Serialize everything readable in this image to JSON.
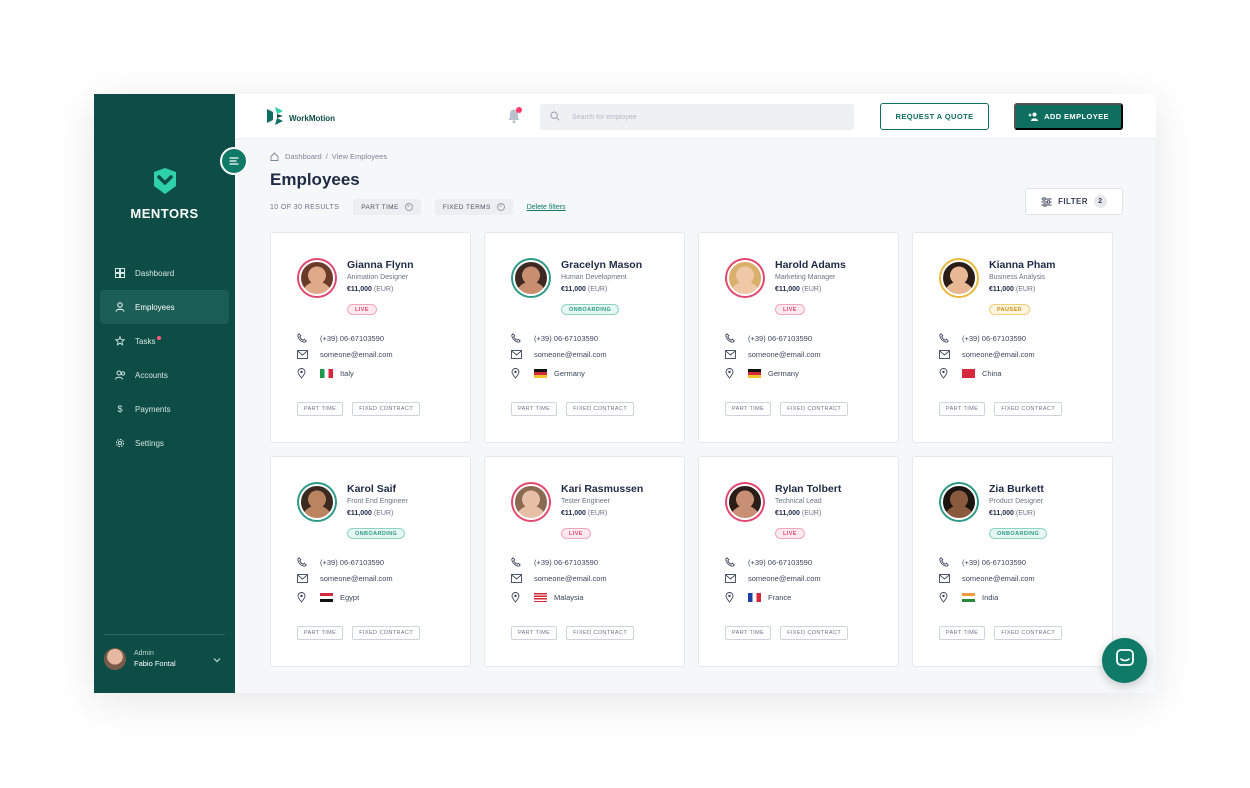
{
  "brand": {
    "name": "MENTORS"
  },
  "topbar": {
    "logo_text": "WorkMotion",
    "search_placeholder": "Search for employee",
    "request_quote": "REQUEST A QUOTE",
    "add_employee": "ADD EMPLOYEE"
  },
  "sidebar": {
    "items": [
      {
        "label": "Dashboard",
        "icon": "dashboard-icon"
      },
      {
        "label": "Employees",
        "icon": "user-icon",
        "active": true
      },
      {
        "label": "Tasks",
        "icon": "star-icon",
        "badge_dot": true
      },
      {
        "label": "Accounts",
        "icon": "users-icon"
      },
      {
        "label": "Payments",
        "icon": "dollar-icon"
      },
      {
        "label": "Settings",
        "icon": "gear-icon"
      }
    ],
    "user": {
      "role": "Admin",
      "name": "Fabio Fontal"
    }
  },
  "breadcrumb": {
    "home": "Dashboard",
    "separator": "/",
    "current": "View Employees"
  },
  "page": {
    "title": "Employees",
    "results": "10 OF 30 RESULTS",
    "filters": [
      "PART TIME",
      "FIXED TERMS"
    ],
    "delete_filters": "Delete filters",
    "filter_label": "FILTER",
    "filter_count": "2"
  },
  "employees": [
    {
      "name": "Gianna Flynn",
      "role": "Animation Designer",
      "salary": "€11,000",
      "currency": "(EUR)",
      "status": "LIVE",
      "phone": "(+39) 06-67103590",
      "email": "someone@email.com",
      "country": "Italy",
      "tags": [
        "PART TIME",
        "FIXED CONTRACT"
      ]
    },
    {
      "name": "Gracelyn Mason",
      "role": "Human Development",
      "salary": "€11,000",
      "currency": "(EUR)",
      "status": "ONBOARDING",
      "phone": "(+39) 06-67103590",
      "email": "someone@email.com",
      "country": "Germany",
      "tags": [
        "PART TIME",
        "FIXED CONTRACT"
      ]
    },
    {
      "name": "Harold Adams",
      "role": "Marketing Manager",
      "salary": "€11,000",
      "currency": "(EUR)",
      "status": "LIVE",
      "phone": "(+39) 06-67103590",
      "email": "someone@email.com",
      "country": "Germany",
      "tags": [
        "PART TIME",
        "FIXED CONTRACT"
      ]
    },
    {
      "name": "Kianna Pham",
      "role": "Business Analysis",
      "salary": "€11,000",
      "currency": "(EUR)",
      "status": "PAUSED",
      "phone": "(+39) 06-67103590",
      "email": "someone@email.com",
      "country": "China",
      "tags": [
        "PART TIME",
        "FIXED CONTRACT"
      ]
    },
    {
      "name": "Karol Saif",
      "role": "Front End Engineer",
      "salary": "€11,000",
      "currency": "(EUR)",
      "status": "ONBOARDING",
      "phone": "(+39) 06-67103590",
      "email": "someone@email.com",
      "country": "Egypt",
      "tags": [
        "PART TIME",
        "FIXED CONTRACT"
      ]
    },
    {
      "name": "Kari Rasmussen",
      "role": "Tester Engineer",
      "salary": "€11,000",
      "currency": "(EUR)",
      "status": "LIVE",
      "phone": "(+39) 06-67103590",
      "email": "someone@email.com",
      "country": "Malaysia",
      "tags": [
        "PART TIME",
        "FIXED CONTRACT"
      ]
    },
    {
      "name": "Rylan Tolbert",
      "role": "Technical Lead",
      "salary": "€11,000",
      "currency": "(EUR)",
      "status": "LIVE",
      "phone": "(+39) 06-67103590",
      "email": "someone@email.com",
      "country": "France",
      "tags": [
        "PART TIME",
        "FIXED CONTRACT"
      ]
    },
    {
      "name": "Zia Burkett",
      "role": "Product Designer",
      "salary": "€11,000",
      "currency": "(EUR)",
      "status": "ONBOARDING",
      "phone": "(+39) 06-67103590",
      "email": "someone@email.com",
      "country": "India",
      "tags": [
        "PART TIME",
        "FIXED CONTRACT"
      ]
    }
  ],
  "colors": {
    "sidebar": "#0e4d45",
    "accent": "#0e6e60",
    "live": "#e2476f",
    "onboarding": "#2c9a87",
    "paused": "#c99013"
  }
}
